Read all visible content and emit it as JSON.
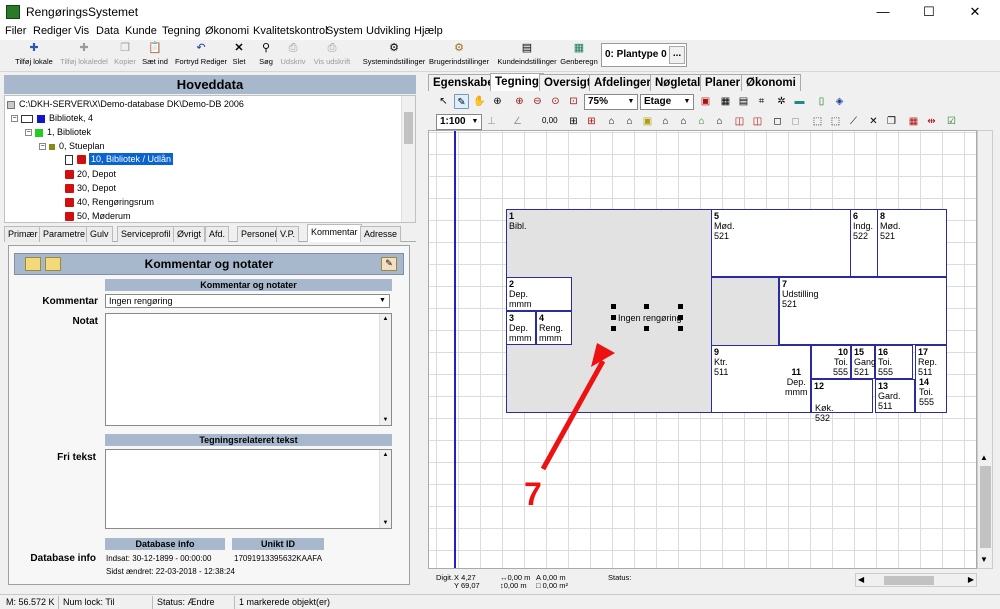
{
  "window": {
    "title": "RengøringsSystemet",
    "minimize": "—",
    "maximize": "☐",
    "close": "✕"
  },
  "menu": [
    "Filer",
    "Rediger",
    "Vis",
    "Data",
    "Kunde",
    "Tegning",
    "Økonomi",
    "Kvalitetskontrol",
    "System",
    "Udvikling",
    "Hjælp"
  ],
  "toolbar": {
    "items": [
      {
        "label": "Tilføj lokale",
        "icon": "add-room-icon",
        "disabled": false
      },
      {
        "label": "Tilføj lokaledel",
        "icon": "add-room-part-icon",
        "disabled": true
      },
      {
        "label": "Kopier",
        "icon": "copy-icon",
        "disabled": true
      },
      {
        "label": "Sæt ind",
        "icon": "paste-icon",
        "disabled": false
      },
      {
        "label": "Fortryd Rediger",
        "icon": "undo-icon",
        "disabled": false
      },
      {
        "label": "Slet",
        "icon": "delete-icon",
        "disabled": false
      },
      {
        "label": "Søg",
        "icon": "binoculars-icon",
        "disabled": false
      },
      {
        "label": "Udskriv",
        "icon": "printer-icon",
        "disabled": true
      },
      {
        "label": "Vis udskrift",
        "icon": "print-preview-icon",
        "disabled": true
      },
      {
        "label": "Systemindstillinger",
        "icon": "system-settings-icon",
        "disabled": false
      },
      {
        "label": "Brugerindstillinger",
        "icon": "user-settings-icon",
        "disabled": false
      },
      {
        "label": "Kundeindstillinger",
        "icon": "customer-settings-icon",
        "disabled": false
      },
      {
        "label": "Genberegn",
        "icon": "recalculate-icon",
        "disabled": false
      }
    ],
    "plantype": "0: Plantype 0",
    "plantype_more": "..."
  },
  "left": {
    "header": "Hoveddata",
    "tree": [
      {
        "label": "C:\\DKH-SERVER\\X\\Demo-database DK\\Demo-DB 2006",
        "level": 0
      },
      {
        "label": "Bibliotek, 4",
        "level": 1
      },
      {
        "label": "1, Bibliotek",
        "level": 2
      },
      {
        "label": "0, Stueplan",
        "level": 3
      },
      {
        "label": "10, Bibliotek / Udlån",
        "level": 4,
        "selected": true
      },
      {
        "label": "20, Depot",
        "level": 4
      },
      {
        "label": "30, Depot",
        "level": 4
      },
      {
        "label": "40, Rengøringsrum",
        "level": 4
      },
      {
        "label": "50, Møderum",
        "level": 4
      }
    ],
    "tabs": [
      "Primær",
      "Parametre",
      "Gulv",
      "Serviceprofil",
      "Øvrigt",
      "Afd.",
      "Personel",
      "V.P.",
      "Kommentar",
      "Adresse"
    ],
    "selected_tab": "Kommentar"
  },
  "comment": {
    "title": "Kommentar og notater",
    "section1": "Kommentar og notater",
    "kommentar_label": "Kommentar",
    "kommentar_value": "Ingen rengøring",
    "notat_label": "Notat",
    "section2": "Tegningsrelateret tekst",
    "fritekst_label": "Fri tekst",
    "dbinfo_header": "Database info",
    "unikt_header": "Unikt ID",
    "dbinfo_label": "Database info",
    "indsat": "Indsat: 30-12-1899 - 00:00:00",
    "sidst": "Sidst ændret: 22-03-2018 - 12:38:24",
    "unikt_id": "17091913395632KAAFA"
  },
  "right_tabs": [
    "Egenskaber",
    "Tegning",
    "Oversigt",
    "Afdelinger",
    "Nøgletal",
    "Planer",
    "Økonomi"
  ],
  "right_selected": "Tegning",
  "drawing": {
    "zoom": "75%",
    "etage": "Etage",
    "scale": "1:100",
    "value": "0,00",
    "selected_label": "Ingen rengøring",
    "annotation": "7",
    "rooms": [
      {
        "num": "1",
        "name": "Bibl.",
        "code": ""
      },
      {
        "num": "5",
        "name": "Mød.",
        "code": "521"
      },
      {
        "num": "6",
        "name": "Indg.",
        "code": "522"
      },
      {
        "num": "8",
        "name": "Mød.",
        "code": "521"
      },
      {
        "num": "2",
        "name": "Dep.",
        "code": "mmm"
      },
      {
        "num": "3",
        "name": "Dep.",
        "code": "mmm"
      },
      {
        "num": "4",
        "name": "Reng.",
        "code": "mmm"
      },
      {
        "num": "7",
        "name": "Udstilling",
        "code": "521"
      },
      {
        "num": "9",
        "name": "Ktr.",
        "code": "511"
      },
      {
        "num": "10",
        "name": "Toi.",
        "code": "555"
      },
      {
        "num": "15",
        "name": "Gang",
        "code": "521"
      },
      {
        "num": "16",
        "name": "Toi.",
        "code": "555"
      },
      {
        "num": "17",
        "name": "Rep.",
        "code": "511"
      },
      {
        "num": "11",
        "name": "Dep.",
        "code": "mmm"
      },
      {
        "num": "12",
        "name": "Køk.",
        "code": "532"
      },
      {
        "num": "13",
        "name": "Gard.",
        "code": "511"
      },
      {
        "num": "14",
        "name": "Toi.",
        "code": "555"
      }
    ],
    "status": {
      "digit_label": "Digit.",
      "x": "X 4,27",
      "y": "Y 69,07",
      "d1": "↔0,00 m",
      "d2": "↕0,00 m",
      "a": "A 0,00 m",
      "area": "□ 0,00 m²",
      "status_label": "Status:"
    }
  },
  "statusbar": {
    "memory": "M: 56.572 K",
    "numlock": "Num lock: Til",
    "status": "Status: Ændre",
    "selection": "1 markerede objekt(er)"
  },
  "colors": {
    "header_blue": "#a7b8cd",
    "room_border": "#2b2ba0",
    "arrow": "#ee1111"
  }
}
